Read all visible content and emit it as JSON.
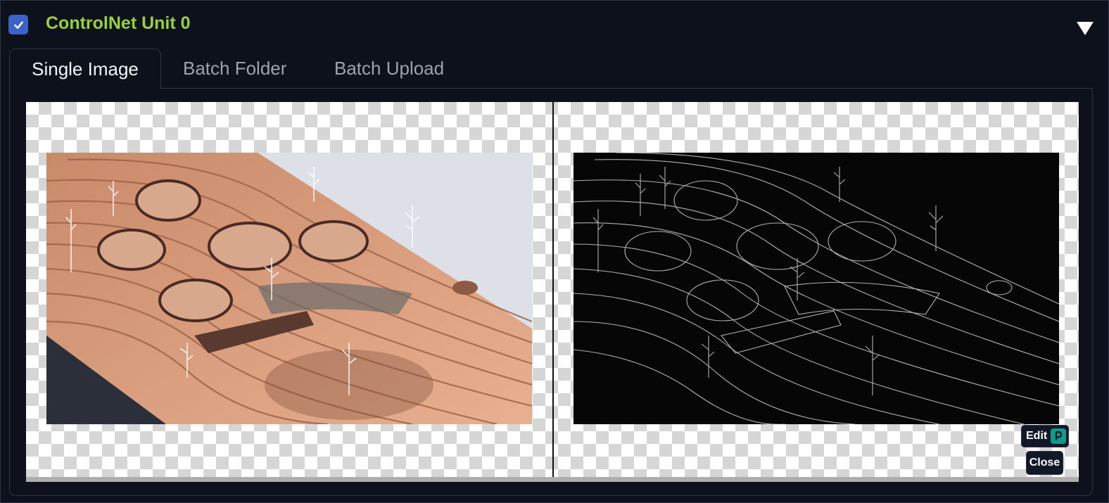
{
  "unit": {
    "enabled": true,
    "title": "ControlNet Unit 0"
  },
  "tabs": [
    {
      "label": "Single Image",
      "active": true
    },
    {
      "label": "Batch Folder",
      "active": false
    },
    {
      "label": "Batch Upload",
      "active": false
    }
  ],
  "preview": {
    "edit_label": "Edit",
    "close_label": "Close"
  },
  "colors": {
    "accent": "#9ad13b",
    "checkbox": "#3a62c9",
    "background": "#0b0f19"
  },
  "icons": {
    "checkbox": "checkmark-icon",
    "collapse": "triangle-down-icon",
    "edit": "photopea-icon"
  }
}
